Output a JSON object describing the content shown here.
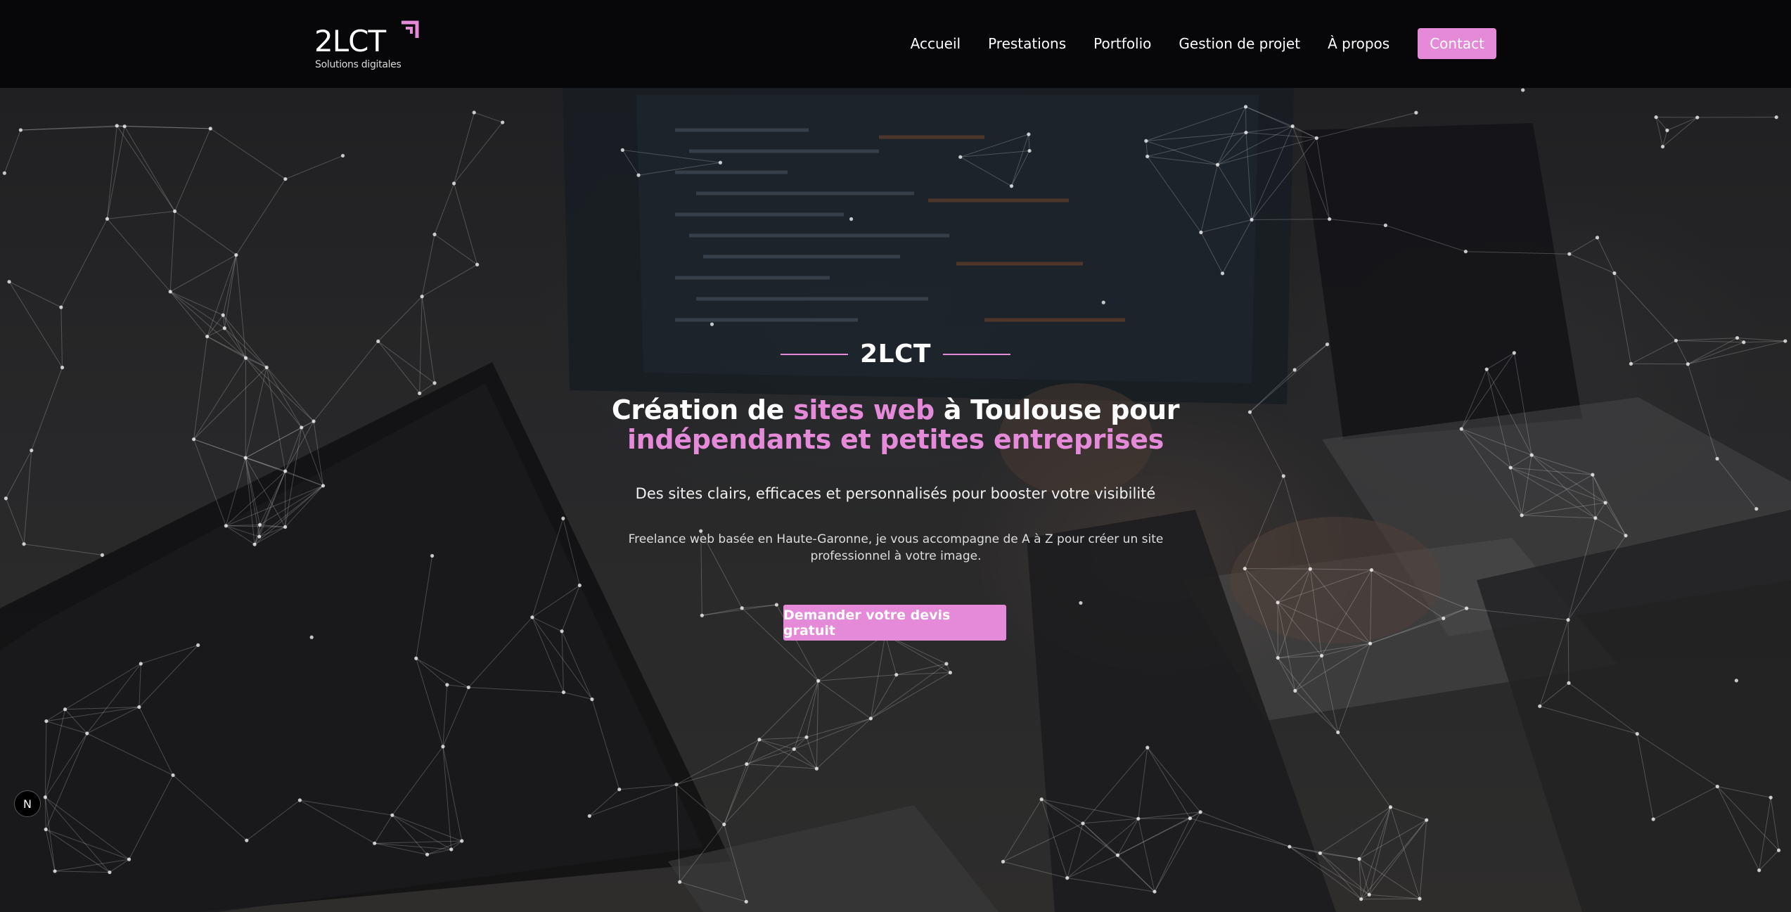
{
  "header": {
    "logo": {
      "name": "2LCT",
      "tagline": "Solutions digitales",
      "mark_icon": "corner-arrow-icon"
    },
    "nav": [
      "Accueil",
      "Prestations",
      "Portfolio",
      "Gestion de projet",
      "À propos"
    ],
    "contact_label": "Contact"
  },
  "hero": {
    "brand": "2LCT",
    "title": {
      "part1": "Création de ",
      "highlight1": "sites web",
      "part2": " à Toulouse pour",
      "highlight2": "indépendants et petites entreprises"
    },
    "subtitle": "Des sites clairs, efficaces et personnalisés pour booster votre visibilité",
    "description": "Freelance web basée en Haute-Garonne, je vous accompagne de A à Z pour créer un site professionnel à votre image.",
    "cta_label": "Demander votre devis gratuit"
  },
  "badge": {
    "label": "N",
    "icon": "nextjs-icon"
  },
  "colors": {
    "accent": "#e48ad8",
    "header_bg": "#07070a",
    "text": "#ffffff"
  }
}
